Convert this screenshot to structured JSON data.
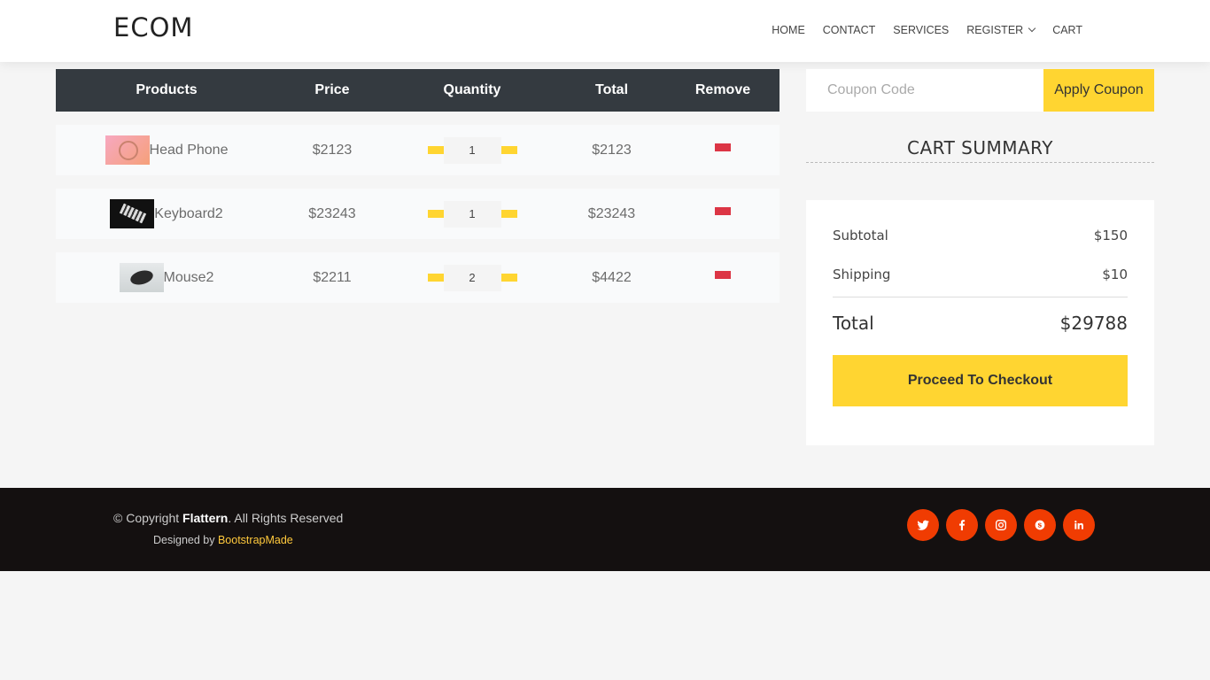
{
  "brand": "ECOM",
  "nav": [
    "HOME",
    "CONTACT",
    "SERVICES",
    "REGISTER",
    "CART"
  ],
  "table": {
    "headers": [
      "Products",
      "Price",
      "Quantity",
      "Total",
      "Remove"
    ],
    "rows": [
      {
        "name": "Head Phone",
        "price": "$2123",
        "qty": "1",
        "total": "$2123"
      },
      {
        "name": "Keyboard2",
        "price": "$23243",
        "qty": "1",
        "total": "$23243"
      },
      {
        "name": "Mouse2",
        "price": "$2211",
        "qty": "2",
        "total": "$4422"
      }
    ]
  },
  "coupon": {
    "placeholder": "Coupon Code",
    "button": "Apply Coupon"
  },
  "summary": {
    "title": "CART SUMMARY",
    "subtotal_label": "Subtotal",
    "subtotal": "$150",
    "shipping_label": "Shipping",
    "shipping": "$10",
    "total_label": "Total",
    "total": "$29788",
    "checkout": "Proceed To Checkout"
  },
  "footer": {
    "copy_pre": "© Copyright ",
    "copy_brand": "Flattern",
    "copy_post": ". All Rights Reserved",
    "designed_pre": "Designed by ",
    "designed_link": "BootstrapMade"
  },
  "socials": [
    "twitter-icon",
    "facebook-icon",
    "instagram-icon",
    "skype-icon",
    "linkedin-icon"
  ],
  "colors": {
    "accent": "#ffd531",
    "danger": "#dc3545",
    "social": "#f03c02",
    "table_head": "#343a40",
    "footer": "#141010"
  }
}
